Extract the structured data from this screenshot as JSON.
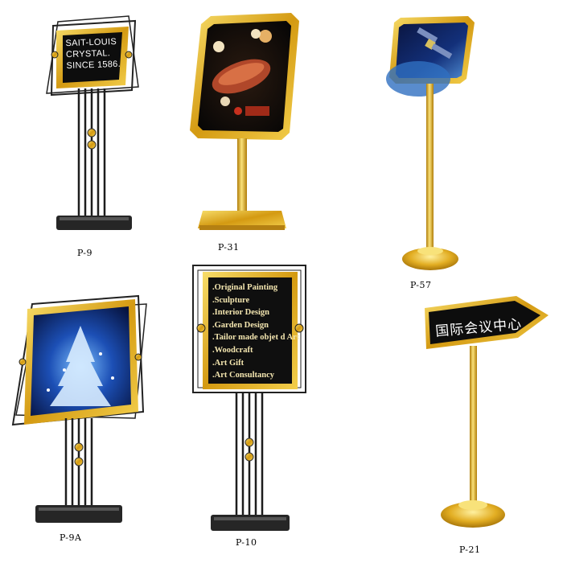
{
  "colors": {
    "gold": "#d9a51c",
    "gold_light": "#f5d35a",
    "black_panel": "#111111",
    "iron": "#1d1d1d"
  },
  "products": [
    {
      "code": "P-9",
      "sign_lines": [
        "SAIT-LOUIS",
        "CRYSTAL.",
        "SINCE 1586."
      ]
    },
    {
      "code": "P-31",
      "image": "food-photo-poster"
    },
    {
      "code": "P-57",
      "image": "satellite-photo-poster"
    },
    {
      "code": "P-9A",
      "image": "christmas-tree-poster"
    },
    {
      "code": "P-10",
      "sign_lines": [
        ".Original Painting",
        ".Sculpture",
        ".Interior Design",
        ".Garden Design",
        ".Tailor made objet d Art",
        ".Woodcraft",
        ".Art Gift",
        ".Art Consultancy"
      ]
    },
    {
      "code": "P-21",
      "sign_text": "国际会议中心"
    }
  ]
}
